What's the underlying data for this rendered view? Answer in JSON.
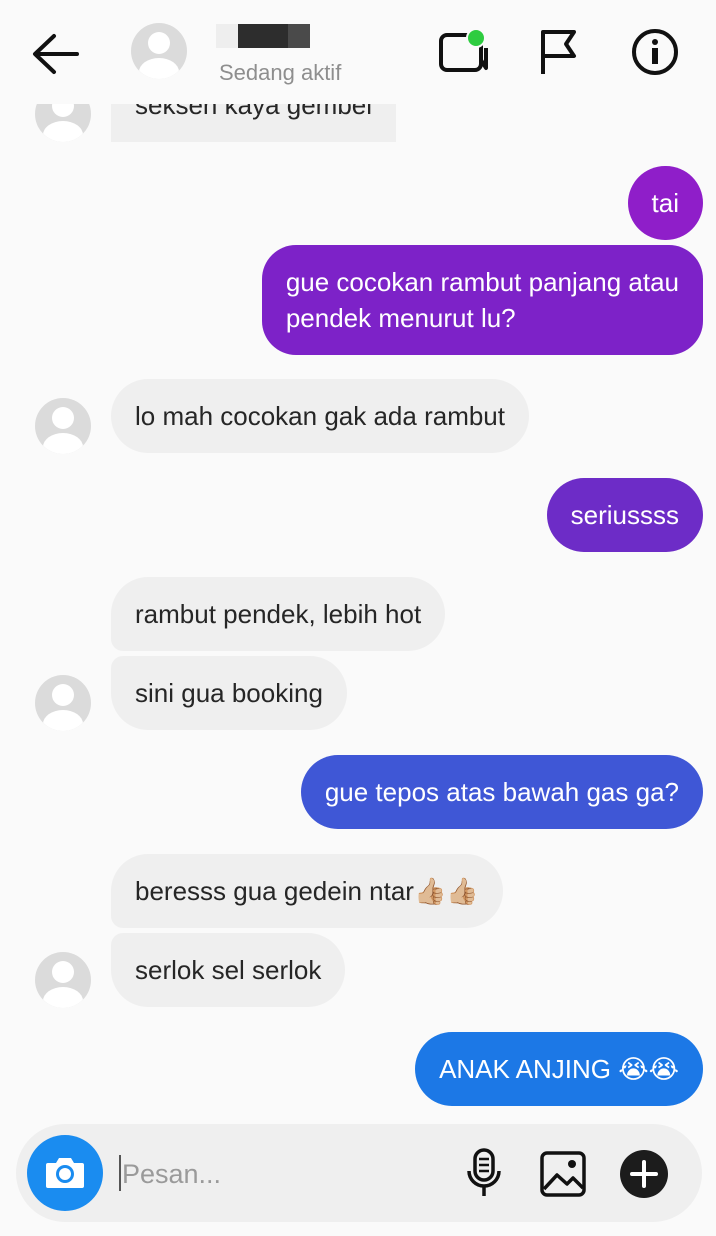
{
  "header": {
    "status": "Sedang aktif",
    "back_icon": "arrow-left-icon",
    "video_icon": "video-call-icon",
    "flag_icon": "flag-icon",
    "info_icon": "info-icon",
    "active_dot_color": "#2ecc40"
  },
  "messages": [
    {
      "side": "in",
      "text": "seksen kaya gembel"
    },
    {
      "side": "out",
      "text": "tai",
      "color": "#8f1ec9"
    },
    {
      "side": "out",
      "text_line1": "gue cocokan rambut panjang atau",
      "text_line2": "pendek menurut lu?",
      "color": "#7d22c8"
    },
    {
      "side": "in",
      "text": "lo mah cocokan gak ada rambut"
    },
    {
      "side": "out",
      "text": "seriussss",
      "color": "#6d2cc7"
    },
    {
      "side": "in",
      "text": "rambut pendek, lebih hot"
    },
    {
      "side": "in",
      "text": "sini gua booking"
    },
    {
      "side": "out",
      "text": "gue tepos atas bawah gas ga?",
      "color": "#3f57d6"
    },
    {
      "side": "in",
      "text": "beresss gua gedein ntar",
      "emoji": "👍🏼👍🏼"
    },
    {
      "side": "in",
      "text": "serlok sel serlok"
    },
    {
      "side": "out",
      "text": "ANAK ANJING",
      "emoji": "😭😭",
      "color": "#1c78e6"
    }
  ],
  "composer": {
    "placeholder": "Pesan...",
    "camera_icon": "camera-icon",
    "mic_icon": "microphone-icon",
    "gallery_icon": "gallery-icon",
    "plus_icon": "plus-icon",
    "camera_color": "#1a8cf0"
  }
}
